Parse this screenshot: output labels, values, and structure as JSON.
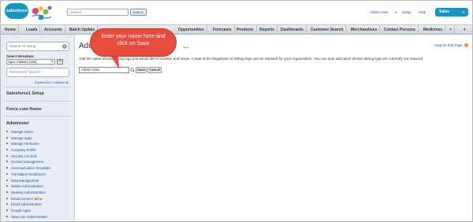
{
  "header": {
    "logo_text": "salesforce",
    "search_placeholder": "Search...",
    "search_button": "Search",
    "user_menu": "Admin User",
    "setup_link": "Setup",
    "help_link": "Help",
    "app_menu": "Sales"
  },
  "tabs": [
    {
      "label": "Home"
    },
    {
      "label": "Leads"
    },
    {
      "label": "Accounts"
    },
    {
      "label": "Batch Update"
    },
    {
      "label": "Opportunities"
    },
    {
      "label": "Forecasts"
    },
    {
      "label": "Products"
    },
    {
      "label": "Reports"
    },
    {
      "label": "Dashboards"
    },
    {
      "label": "Customer Search"
    },
    {
      "label": "Merchandises"
    },
    {
      "label": "Contact Persons"
    },
    {
      "label": "Medicines"
    },
    {
      "label": "+"
    }
  ],
  "sidebar": {
    "quick_find_placeholder": "Search All Setup...",
    "select_metadata_label": "Select Metadata:",
    "metadata_value": "Apex Classes (152)",
    "advanced_search_placeholder": "Advanced Search",
    "expand_all": "Expand All",
    "separator": "|",
    "collapse_all": "Collapse All",
    "salesforce1_setup": "Salesforce1 Setup",
    "forcecom_home": "Force.com Home",
    "administer": "Administer",
    "admin_items": [
      {
        "label": "Manage Users"
      },
      {
        "label": "Manage Apps"
      },
      {
        "label": "Manage Territories"
      },
      {
        "label": "Company Profile"
      },
      {
        "label": "Security Controls"
      },
      {
        "label": "Domain Management"
      },
      {
        "label": "Communication Templates"
      },
      {
        "label": "Translation Workbench"
      },
      {
        "label": "Data Management"
      },
      {
        "label": "Mobile Administration"
      },
      {
        "label": "Desktop Administration"
      },
      {
        "label": "Email Connect",
        "badge": "BETA"
      },
      {
        "label": "Email Administration"
      },
      {
        "label": "Google Apps"
      },
      {
        "label": "Data.com Administration"
      }
    ]
  },
  "main": {
    "title_start": "Add",
    "title_end": "...",
    "help_for_page": "Help for this Page",
    "instructions": "Add the users whose debug logs you would like to monitor and retain. A total of 50 megabytes of debug logs can be retained for your organization. You can only add users whose debug logs are currently not retained.",
    "name_value": "Admin User",
    "save_label": "Save",
    "cancel_label": "Cancel"
  },
  "callout": {
    "line1": "Enter your name here and",
    "line2": "click on Save"
  }
}
